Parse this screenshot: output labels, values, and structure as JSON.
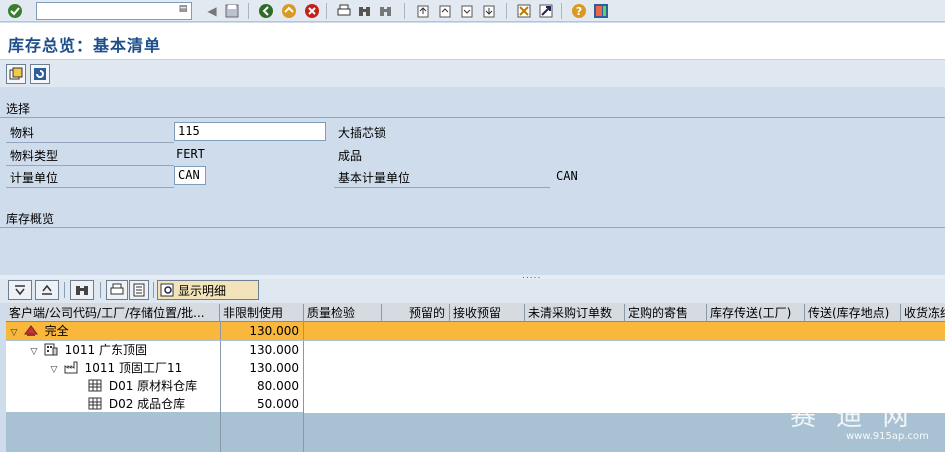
{
  "toolbar": {
    "command_value": "",
    "icons": [
      "enter-icon",
      "save-icon",
      "back-icon",
      "exit-icon",
      "cancel-icon",
      "print-icon",
      "find-icon",
      "find-next-icon",
      "first-page-icon",
      "prev-page-icon",
      "next-page-icon",
      "last-page-icon",
      "new-session-icon",
      "shortcut-icon",
      "help-icon",
      "layout-icon"
    ]
  },
  "title": "库存总览：基本清单",
  "selection": {
    "section_label": "选择",
    "material_label": "物料",
    "material_value": "115",
    "material_desc": "大插芯锁",
    "material_type_label": "物料类型",
    "material_type_value": "FERT",
    "material_type_desc": "成品",
    "uom_label": "计量单位",
    "uom_value": "CAN",
    "base_uom_label": "基本计量单位",
    "base_uom_value": "CAN"
  },
  "overview": {
    "section_label": "库存概览",
    "splitter_dots": "....."
  },
  "grid_toolbar": {
    "details_label": "显示明细"
  },
  "grid": {
    "headers": [
      "客户端/公司代码/工厂/存储位置/批...",
      "非限制使用",
      "质量检验",
      "预留的",
      "接收预留",
      "未清采购订单数",
      "定购的寄售",
      "库存传送(工厂)",
      "传送(库存地点)",
      "收货冻结"
    ],
    "rows": [
      {
        "label": "完全",
        "value": "130.000"
      },
      {
        "label": "1011 广东顶固",
        "value": "130.000"
      },
      {
        "label": "1011 顶固工厂11",
        "value": "130.000"
      },
      {
        "label": "D01 原材料仓库",
        "value": "80.000"
      },
      {
        "label": "D02 成品仓库",
        "value": "50.000"
      }
    ]
  },
  "watermark": {
    "text": "赛 迪 网",
    "url": "www.915ap.com"
  },
  "colors": {
    "title": "#1c4e8c",
    "selected_row": "#f9b73b",
    "background": "#cfdceb"
  }
}
